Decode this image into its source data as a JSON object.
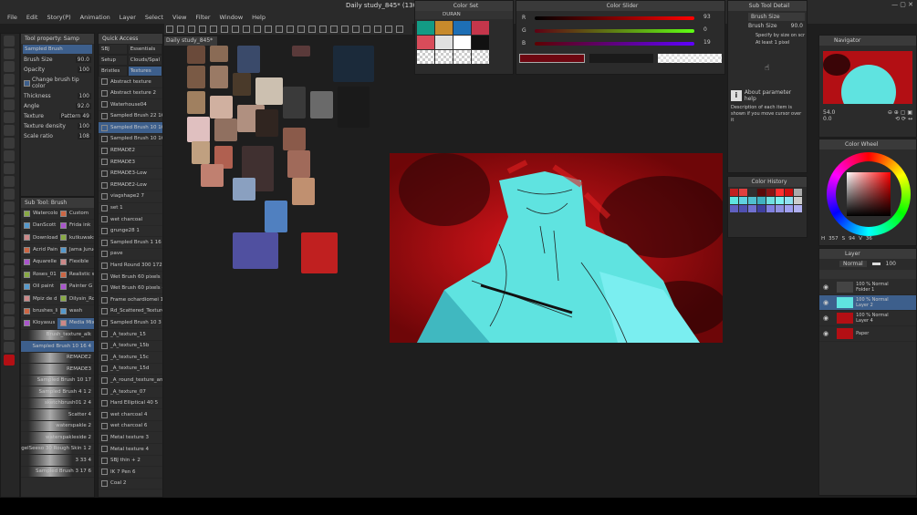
{
  "window": {
    "title": "Daily study_845* (130"
  },
  "menu": [
    "File",
    "Edit",
    "Story(P)",
    "Animation",
    "Layer",
    "Select",
    "View",
    "Filter",
    "Window",
    "Help"
  ],
  "tool_property": {
    "title": "Tool property: Samp",
    "brush_name": "Sampled Brush",
    "brush_size_label": "Brush Size",
    "brush_size": "90.0",
    "opacity_label": "Opacity",
    "opacity": "100",
    "change_tip_color": "Change brush tip color",
    "thickness_label": "Thickness",
    "thickness": "100",
    "angle_label": "Angle",
    "angle": "92.0",
    "texture_label": "Texture",
    "texture_value": "Pattern 49",
    "texture_density_label": "Texture density",
    "texture_density": "100",
    "scale_ratio_label": "Scale ratio",
    "scale_ratio": "108"
  },
  "sub_tool": {
    "title": "Sub Tool: Brush",
    "cells": [
      "Watercolor",
      "Custom",
      "DanScott 6",
      "Frida ink",
      "Download",
      "kutkuwaks",
      "Acrid Paint",
      "Jama Jurue",
      "Aquarelle",
      "Flexible",
      "Roses_01",
      "Realistic w",
      "Oil paint",
      "Painter G",
      "Mpiz de dr",
      "Dilysin_Ro",
      "brushes_li",
      "wash",
      "Kloyasus",
      "Media Mix"
    ],
    "brush_list": [
      "Brush_texture_alk",
      "Sampled Brush 10 16 4",
      "REMADE2",
      "REMADE3",
      "Sampled Brush 10 17",
      "Sampled Brush 4 1 2",
      "sketchbrush01 2 4",
      "Scatter 4",
      "waterspakle 2",
      "waterspakleside 2",
      "NagelSeeso 30 Rough Skin 1 2",
      "3 33 4",
      "Sampled Brush 3 17 6"
    ]
  },
  "quick_access": {
    "title": "Quick Access",
    "tabs": [
      "SBJ",
      "Essentials",
      "Setup",
      "Clouds/Spal",
      "Bristles",
      "Textures"
    ],
    "items": [
      "Abstract texture",
      "Abstract texture 2",
      "Waterhouse04",
      "Sampled Brush 22 1604",
      "Sampled Brush 10 16 4",
      "Sampled Brush 10 16.L",
      "REMADE2",
      "REMADE3",
      "REMADE3-Low",
      "REMADE2-Low",
      "viagshape2 7",
      "set 1",
      "wet charcoal",
      "grunge28 1",
      "Sampled Brush 1 16",
      "pave",
      "Hard Round 300 1728",
      "Wet Brush 60 pixels 1",
      "Wet Brush 60 pixels #2",
      "Frame ochardiomei 15",
      "Rd_Scattered_Texture",
      "Sampled Brush 10 3",
      "_A_texture_15",
      "_A_texture_15b",
      "_A_texture_15c",
      "_A_texture_15d",
      "_A_round_texture_anal",
      "_A_texture_07",
      "Hard Elliptical 40 5",
      "wet charcoal 4",
      "wet charcoal 6",
      "Metal texture 3",
      "Metal texture 4",
      "SBJ thin + 2",
      "IK 7 Pen 6",
      "Coal 2"
    ]
  },
  "canvas_tab": "Daily study_845*",
  "color_set": {
    "title": "Color Set",
    "name": "DURAN"
  },
  "color_slider": {
    "title": "Color Slider",
    "r": "93",
    "g": "0",
    "b": "19",
    "labels": [
      "R",
      "G",
      "B"
    ]
  },
  "sub_tool_detail": {
    "title": "Sub Tool Detail",
    "section": "Brush Size",
    "brush_size_label": "Brush Size",
    "brush_size": "90.0",
    "opt1": "Specify by size on scr",
    "opt2": "At least 1 pixel",
    "help_title": "About parameter help",
    "help_text": "Description of each item is shown if you move cursor over it"
  },
  "color_history": {
    "title": "Color History"
  },
  "navigator": {
    "title": "Navigator",
    "zoom": "54.0",
    "rotate": "0.0"
  },
  "color_wheel": {
    "title": "Color Wheel",
    "h": "357",
    "s": "94",
    "v": "36",
    "labels": [
      "H",
      "S",
      "V"
    ]
  },
  "layer": {
    "title": "Layer",
    "blend": "Normal",
    "opacity": "100",
    "items": [
      {
        "mode": "100 % Normal",
        "name": "Folder 1"
      },
      {
        "mode": "100 % Normal",
        "name": "Layer 2"
      },
      {
        "mode": "100 % Normal",
        "name": "Layer 4"
      },
      {
        "mode": "",
        "name": "Paper"
      }
    ]
  },
  "colors": {
    "accent": "#3d5f8c",
    "canvas_red": "#b30f14",
    "cyan": "#5fe3e0"
  }
}
